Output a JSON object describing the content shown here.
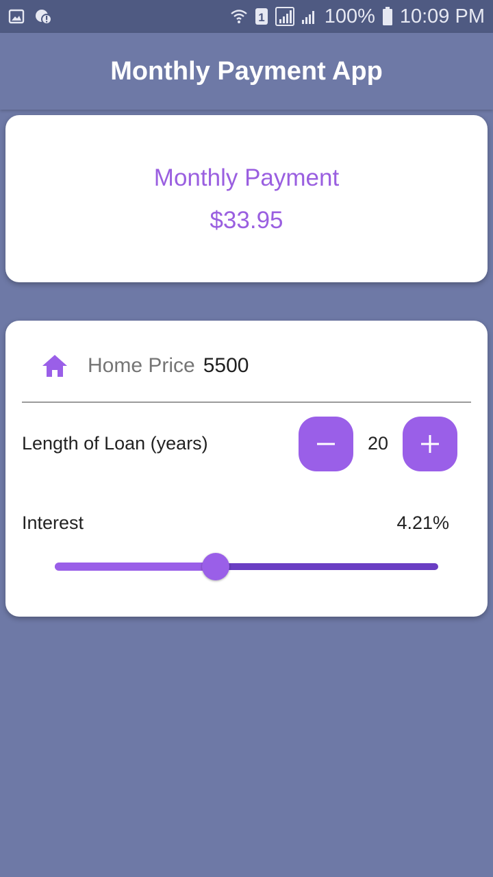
{
  "status_bar": {
    "battery": "100%",
    "time": "10:09 PM",
    "sim_slot": "1",
    "icons": [
      "image-icon",
      "notification-icon",
      "wifi-icon",
      "sim-icon",
      "signal-icon",
      "signal-icon",
      "battery-icon"
    ]
  },
  "app_bar": {
    "title": "Monthly Payment App"
  },
  "payment": {
    "label": "Monthly Payment",
    "value": "$33.95"
  },
  "form": {
    "home_price_label": "Home Price",
    "home_price_value": "5500",
    "loan_label": "Length of Loan (years)",
    "loan_value": "20",
    "interest_label": "Interest",
    "interest_value": "4.21%",
    "interest_slider_fraction": 0.42
  },
  "colors": {
    "accent": "#9a5fe8",
    "background": "#6e79a6",
    "status_bar": "#4f5a82"
  }
}
